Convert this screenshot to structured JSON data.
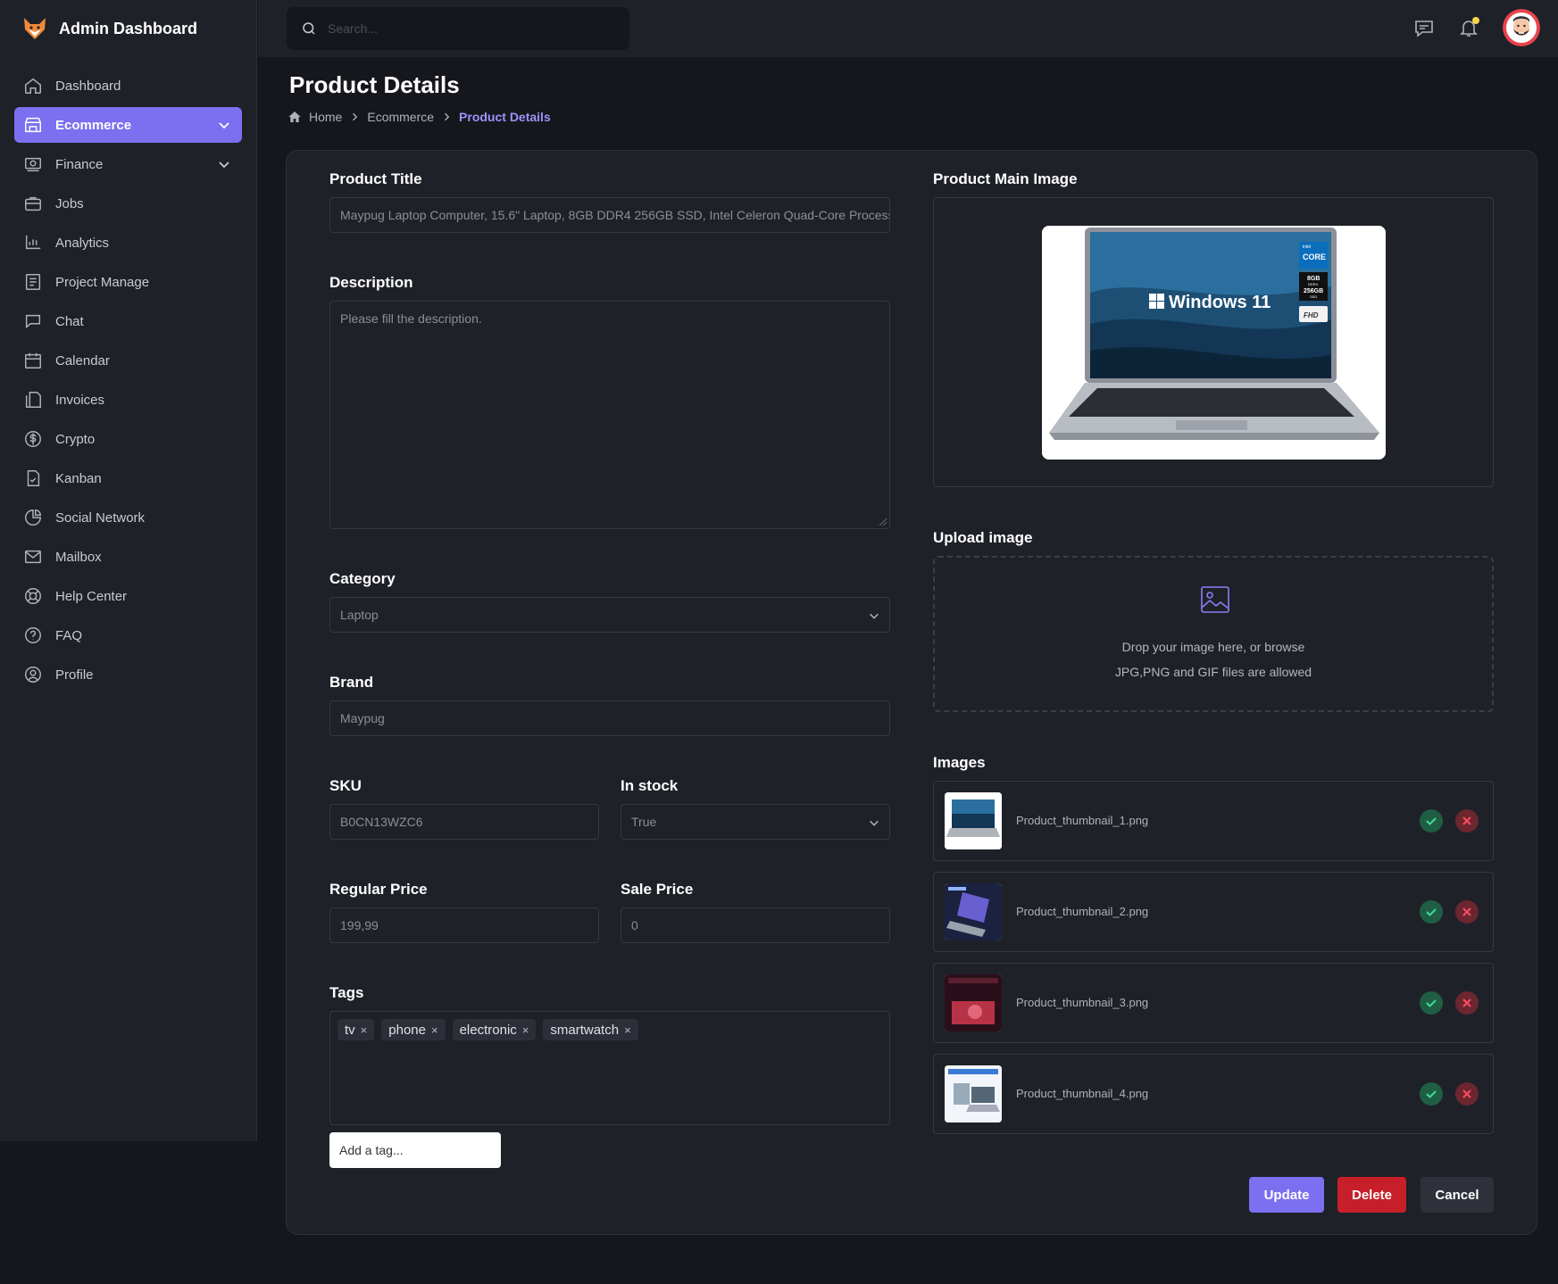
{
  "app": {
    "title": "Admin Dashboard"
  },
  "sidebar": {
    "items": [
      {
        "label": "Dashboard",
        "icon": "home-icon"
      },
      {
        "label": "Ecommerce",
        "icon": "store-icon",
        "active": true,
        "expandable": true
      },
      {
        "label": "Finance",
        "icon": "finance-icon",
        "expandable": true
      },
      {
        "label": "Jobs",
        "icon": "briefcase-icon"
      },
      {
        "label": "Analytics",
        "icon": "analytics-icon"
      },
      {
        "label": "Project Manage",
        "icon": "project-icon"
      },
      {
        "label": "Chat",
        "icon": "chat-icon"
      },
      {
        "label": "Calendar",
        "icon": "calendar-icon"
      },
      {
        "label": "Invoices",
        "icon": "invoice-icon"
      },
      {
        "label": "Crypto",
        "icon": "dollar-icon"
      },
      {
        "label": "Kanban",
        "icon": "kanban-icon"
      },
      {
        "label": "Social Network",
        "icon": "pie-icon"
      },
      {
        "label": "Mailbox",
        "icon": "mail-icon"
      },
      {
        "label": "Help Center",
        "icon": "lifebuoy-icon"
      },
      {
        "label": "FAQ",
        "icon": "question-icon"
      },
      {
        "label": "Profile",
        "icon": "user-icon"
      }
    ]
  },
  "search": {
    "placeholder": "Search..."
  },
  "page": {
    "title": "Product Details",
    "breadcrumb": {
      "home": "Home",
      "parent": "Ecommerce",
      "current": "Product Details"
    }
  },
  "form": {
    "product_title": {
      "label": "Product Title",
      "value": "Maypug Laptop Computer, 15.6\" Laptop, 8GB DDR4 256GB SSD, Intel Celeron Quad-Core Processor"
    },
    "description": {
      "label": "Description",
      "placeholder": "Please fill the description."
    },
    "category": {
      "label": "Category",
      "value": "Laptop"
    },
    "brand": {
      "label": "Brand",
      "value": "Maypug"
    },
    "sku": {
      "label": "SKU",
      "value": "B0CN13WZC6"
    },
    "in_stock": {
      "label": "In stock",
      "value": "True"
    },
    "regular_price": {
      "label": "Regular Price",
      "value": "199,99"
    },
    "sale_price": {
      "label": "Sale Price",
      "value": "0"
    },
    "tags": {
      "label": "Tags",
      "items": [
        "tv",
        "phone",
        "electronic",
        "smartwatch"
      ],
      "remove_symbol": "×",
      "add_placeholder": "Add a tag..."
    }
  },
  "media": {
    "main_image_label": "Product Main Image",
    "main_image_texts": {
      "os": "Windows 11",
      "cpu_top": "intel",
      "cpu": "CORE",
      "ram": "8GB",
      "ram_type": "DDR4",
      "storage": "256GB",
      "storage_type": "SSD",
      "display": "FHD"
    },
    "upload_label": "Upload image",
    "upload_text": "Drop your image here, or browse",
    "upload_hint": "JPG,PNG and GIF files are allowed",
    "images_label": "Images",
    "images": [
      {
        "name": "Product_thumbnail_1.png"
      },
      {
        "name": "Product_thumbnail_2.png"
      },
      {
        "name": "Product_thumbnail_3.png"
      },
      {
        "name": "Product_thumbnail_4.png"
      }
    ]
  },
  "actions": {
    "update": "Update",
    "delete": "Delete",
    "cancel": "Cancel"
  },
  "colors": {
    "accent": "#7c6ff0",
    "danger": "#c61f2a",
    "success": "#3ddc97",
    "background": "#15171c",
    "panel": "#1f2128"
  }
}
